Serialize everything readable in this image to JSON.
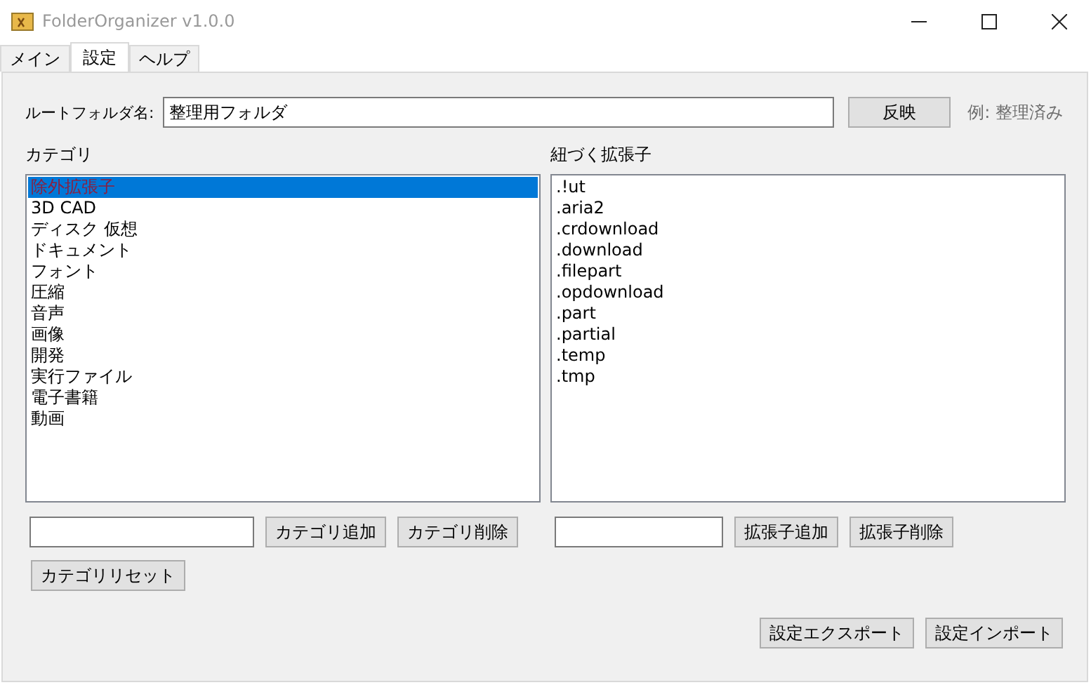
{
  "window": {
    "title": "FolderOrganizer v1.0.0"
  },
  "tabs": [
    {
      "label": "メイン",
      "selected": false
    },
    {
      "label": "設定",
      "selected": true
    },
    {
      "label": "ヘルプ",
      "selected": false
    }
  ],
  "root_folder": {
    "label": "ルートフォルダ名:",
    "value": "整理用フォルダ",
    "button": "反映",
    "hint": "例: 整理済み"
  },
  "categories": {
    "label": "カテゴリ",
    "items": [
      {
        "label": "除外拡張子",
        "selected": true
      },
      {
        "label": "3D CAD",
        "selected": false
      },
      {
        "label": "ディスク 仮想",
        "selected": false
      },
      {
        "label": "ドキュメント",
        "selected": false
      },
      {
        "label": "フォント",
        "selected": false
      },
      {
        "label": "圧縮",
        "selected": false
      },
      {
        "label": "音声",
        "selected": false
      },
      {
        "label": "画像",
        "selected": false
      },
      {
        "label": "開発",
        "selected": false
      },
      {
        "label": "実行ファイル",
        "selected": false
      },
      {
        "label": "電子書籍",
        "selected": false
      },
      {
        "label": "動画",
        "selected": false
      }
    ],
    "buttons": [
      "カテゴリ追加",
      "カテゴリ削除"
    ],
    "reset_button": "カテゴリリセット"
  },
  "extensions": {
    "label": "紐づく拡張子",
    "items": [
      ".!ut",
      ".aria2",
      ".crdownload",
      ".download",
      ".filepart",
      ".opdownload",
      ".part",
      ".partial",
      ".temp",
      ".tmp"
    ],
    "buttons": [
      "拡張子追加",
      "拡張子削除"
    ]
  },
  "footer_buttons": [
    "設定エクスポート",
    "設定インポート"
  ]
}
